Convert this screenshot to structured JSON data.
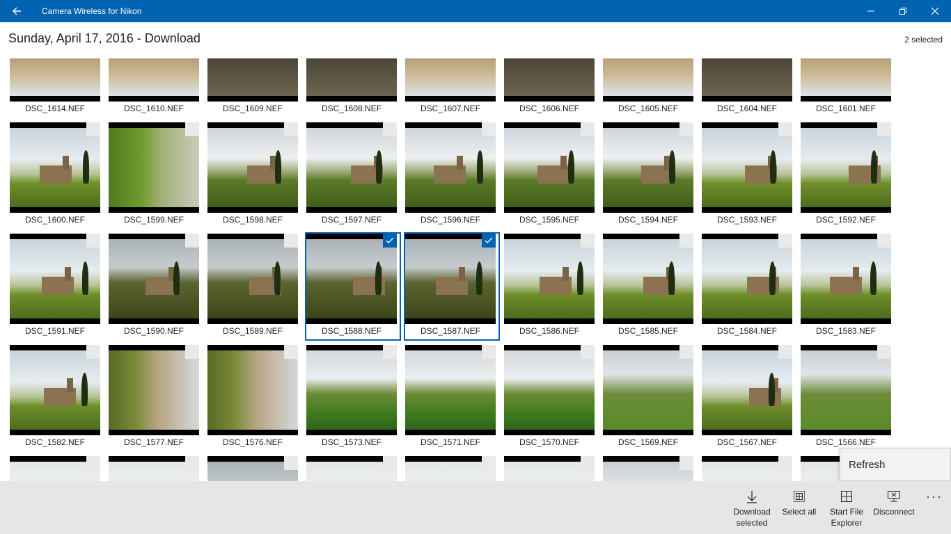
{
  "window": {
    "title": "Camera Wireless for Nikon",
    "accent": "#0063b1"
  },
  "header": {
    "title": "Sunday, April 17, 2016 - Download",
    "selected_text": "2 selected"
  },
  "photos": [
    {
      "name": "DSC_1614.NEF",
      "style": "p-top",
      "selected": false
    },
    {
      "name": "DSC_1610.NEF",
      "style": "p-top",
      "selected": false
    },
    {
      "name": "DSC_1609.NEF",
      "style": "p-topdark",
      "selected": false
    },
    {
      "name": "DSC_1608.NEF",
      "style": "p-topdark",
      "selected": false
    },
    {
      "name": "DSC_1607.NEF",
      "style": "p-top",
      "selected": false
    },
    {
      "name": "DSC_1606.NEF",
      "style": "p-topdark",
      "selected": false
    },
    {
      "name": "DSC_1605.NEF",
      "style": "p-top",
      "selected": false
    },
    {
      "name": "DSC_1604.NEF",
      "style": "p-topdark",
      "selected": false
    },
    {
      "name": "DSC_1601.NEF",
      "style": "p-top",
      "selected": false
    },
    {
      "name": "DSC_1600.NEF",
      "style": "p-field",
      "selected": false
    },
    {
      "name": "DSC_1599.NEF",
      "style": "p-grass",
      "selected": false
    },
    {
      "name": "DSC_1598.NEF",
      "style": "p-meadow",
      "selected": false
    },
    {
      "name": "DSC_1597.NEF",
      "style": "p-meadow",
      "selected": false
    },
    {
      "name": "DSC_1596.NEF",
      "style": "p-meadow",
      "selected": false
    },
    {
      "name": "DSC_1595.NEF",
      "style": "p-meadow",
      "selected": false
    },
    {
      "name": "DSC_1594.NEF",
      "style": "p-meadow",
      "selected": false
    },
    {
      "name": "DSC_1593.NEF",
      "style": "p-field",
      "selected": false
    },
    {
      "name": "DSC_1592.NEF",
      "style": "p-field",
      "selected": false
    },
    {
      "name": "DSC_1591.NEF",
      "style": "p-field",
      "selected": false
    },
    {
      "name": "DSC_1590.NEF",
      "style": "p-dark",
      "selected": false
    },
    {
      "name": "DSC_1589.NEF",
      "style": "p-dark",
      "selected": false
    },
    {
      "name": "DSC_1588.NEF",
      "style": "p-dark",
      "selected": true
    },
    {
      "name": "DSC_1587.NEF",
      "style": "p-dark",
      "selected": true
    },
    {
      "name": "DSC_1586.NEF",
      "style": "p-field",
      "selected": false
    },
    {
      "name": "DSC_1585.NEF",
      "style": "p-field",
      "selected": false
    },
    {
      "name": "DSC_1584.NEF",
      "style": "p-field",
      "selected": false
    },
    {
      "name": "DSC_1583.NEF",
      "style": "p-field",
      "selected": false
    },
    {
      "name": "DSC_1582.NEF",
      "style": "p-field",
      "selected": false
    },
    {
      "name": "DSC_1577.NEF",
      "style": "p-rot",
      "selected": false
    },
    {
      "name": "DSC_1576.NEF",
      "style": "p-rot",
      "selected": false
    },
    {
      "name": "DSC_1573.NEF",
      "style": "p-green",
      "selected": false
    },
    {
      "name": "DSC_1571.NEF",
      "style": "p-green",
      "selected": false
    },
    {
      "name": "DSC_1570.NEF",
      "style": "p-green",
      "selected": false
    },
    {
      "name": "DSC_1569.NEF",
      "style": "p-hill",
      "selected": false
    },
    {
      "name": "DSC_1567.NEF",
      "style": "p-field",
      "selected": false
    },
    {
      "name": "DSC_1566.NEF",
      "style": "p-hill",
      "selected": false
    },
    {
      "name": "",
      "style": "p-misty",
      "selected": false
    },
    {
      "name": "",
      "style": "p-misty",
      "selected": false
    },
    {
      "name": "",
      "style": "p-dark",
      "selected": false
    },
    {
      "name": "",
      "style": "p-misty",
      "selected": false
    },
    {
      "name": "",
      "style": "p-misty",
      "selected": false
    },
    {
      "name": "",
      "style": "p-misty",
      "selected": false
    },
    {
      "name": "",
      "style": "p-hill",
      "selected": false
    },
    {
      "name": "",
      "style": "p-misty",
      "selected": false
    },
    {
      "name": "",
      "style": "p-misty",
      "selected": false
    }
  ],
  "context_menu": {
    "refresh_label": "Refresh"
  },
  "commands": {
    "download_line1": "Download",
    "download_line2": "selected",
    "select_all": "Select all",
    "explorer_line1": "Start File",
    "explorer_line2": "Explorer",
    "disconnect": "Disconnect",
    "more": "···"
  }
}
